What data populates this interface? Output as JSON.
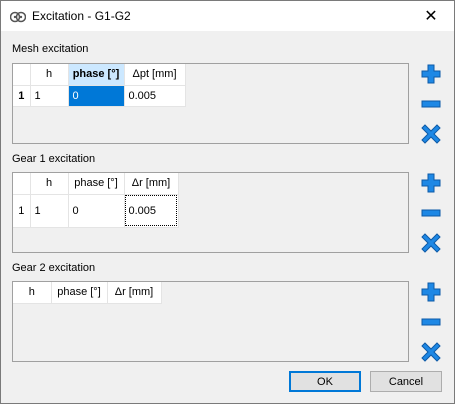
{
  "window": {
    "title": "Excitation - G1-G2",
    "close_glyph": "✕"
  },
  "mesh": {
    "label": "Mesh excitation",
    "columns": [
      "h",
      "phase [°]",
      "Δpt [mm]"
    ],
    "rows": [
      {
        "index": "1",
        "h": "1",
        "phase": "0",
        "value": "0.005"
      }
    ]
  },
  "gear1": {
    "label": "Gear 1 excitation",
    "columns": [
      "h",
      "phase [°]",
      "Δr [mm]"
    ],
    "rows": [
      {
        "index": "1",
        "h": "1",
        "phase": "0",
        "value": "0.005"
      }
    ]
  },
  "gear2": {
    "label": "Gear 2 excitation",
    "columns": [
      "h",
      "phase [°]",
      "Δr [mm]"
    ],
    "rows": []
  },
  "buttons": {
    "ok": "OK",
    "cancel": "Cancel"
  },
  "icons": {
    "add": "plus-icon",
    "remove": "minus-icon",
    "delete": "x-icon"
  },
  "colors": {
    "accent": "#0078d7",
    "icon_blue": "#1e88e5"
  }
}
